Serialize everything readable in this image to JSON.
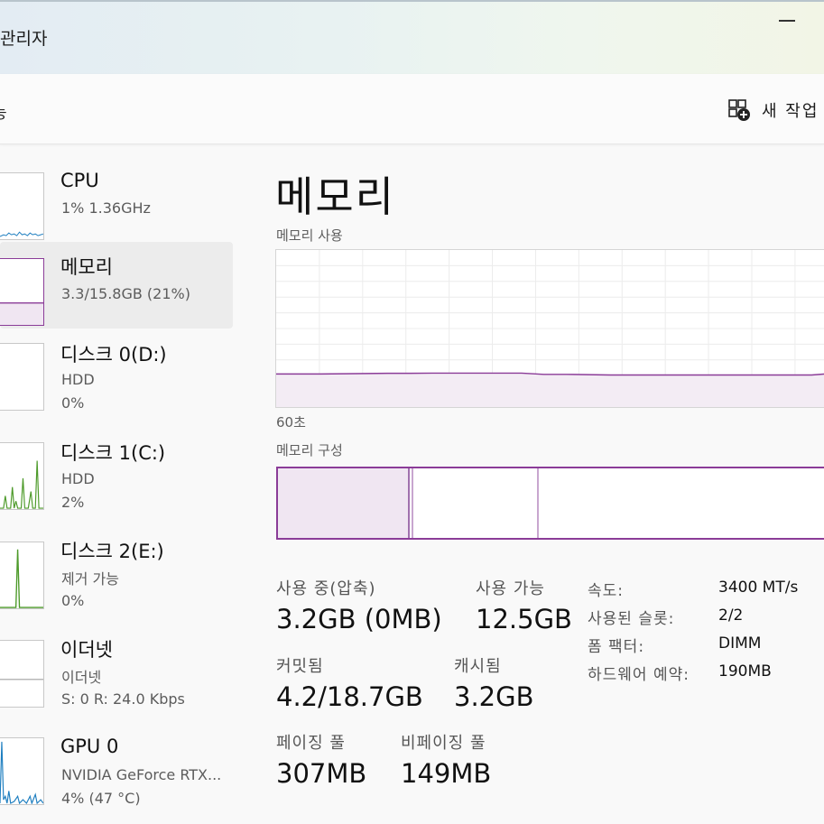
{
  "window": {
    "title": "관리자"
  },
  "cmdbar": {
    "left_label": "능",
    "new_task_label": "새 작업"
  },
  "sidebar": {
    "items": [
      {
        "name": "CPU",
        "line1": "1% 1.36GHz",
        "line2": ""
      },
      {
        "name": "메모리",
        "line1": "3.3/15.8GB (21%)",
        "line2": ""
      },
      {
        "name": "디스크 0(D:)",
        "line1": "HDD",
        "line2": "0%"
      },
      {
        "name": "디스크 1(C:)",
        "line1": "HDD",
        "line2": "2%"
      },
      {
        "name": "디스크 2(E:)",
        "line1": "제거 가능",
        "line2": "0%"
      },
      {
        "name": "이더넷",
        "line1": "이더넷",
        "line2": "S: 0 R: 24.0 Kbps"
      },
      {
        "name": "GPU 0",
        "line1": "NVIDIA GeForce RTX...",
        "line2": "4% (47 °C)"
      }
    ]
  },
  "main": {
    "title": "메모리",
    "usage_graph_label": "메모리 사용",
    "time_span_label": "60초",
    "composition_label": "메모리 구성",
    "stats": {
      "in_use_label": "사용 중(압축)",
      "in_use_value": "3.2GB (0MB)",
      "available_label": "사용 가능",
      "available_value": "12.5GB",
      "committed_label": "커밋됨",
      "committed_value": "4.2/18.7GB",
      "cached_label": "캐시됨",
      "cached_value": "3.2GB",
      "paged_pool_label": "페이징 풀",
      "paged_pool_value": "307MB",
      "nonpaged_pool_label": "비페이징 풀",
      "nonpaged_pool_value": "149MB"
    },
    "specs": [
      {
        "key": "속도:",
        "value": "3400 MT/s"
      },
      {
        "key": "사용된 슬롯:",
        "value": "2/2"
      },
      {
        "key": "폼 팩터:",
        "value": "DIMM"
      },
      {
        "key": "하드웨어 예약:",
        "value": "190MB"
      }
    ]
  },
  "colors": {
    "memory_accent": "#8b3c98",
    "memory_fill": "#f0e6f2",
    "cpu_line": "#1f7fc0",
    "disk_line": "#4d9a2a",
    "gpu_line": "#1f7fc0",
    "ethernet_line": "#a0a0a0"
  },
  "chart_data": {
    "type": "area",
    "title": "메모리 사용",
    "xlabel": "60초",
    "series": [
      {
        "values": [
          21,
          21,
          21,
          21.2,
          21.3,
          21.5,
          21.5,
          21.6,
          21.6,
          21.6,
          21.6,
          21.6,
          20.8,
          20.8,
          20.6,
          20.4,
          20.4,
          20.4,
          20.4,
          20.4,
          20.4,
          20.4,
          20.4,
          20.4,
          20.4,
          21.5
        ]
      }
    ],
    "ylim": [
      0,
      100
    ]
  }
}
